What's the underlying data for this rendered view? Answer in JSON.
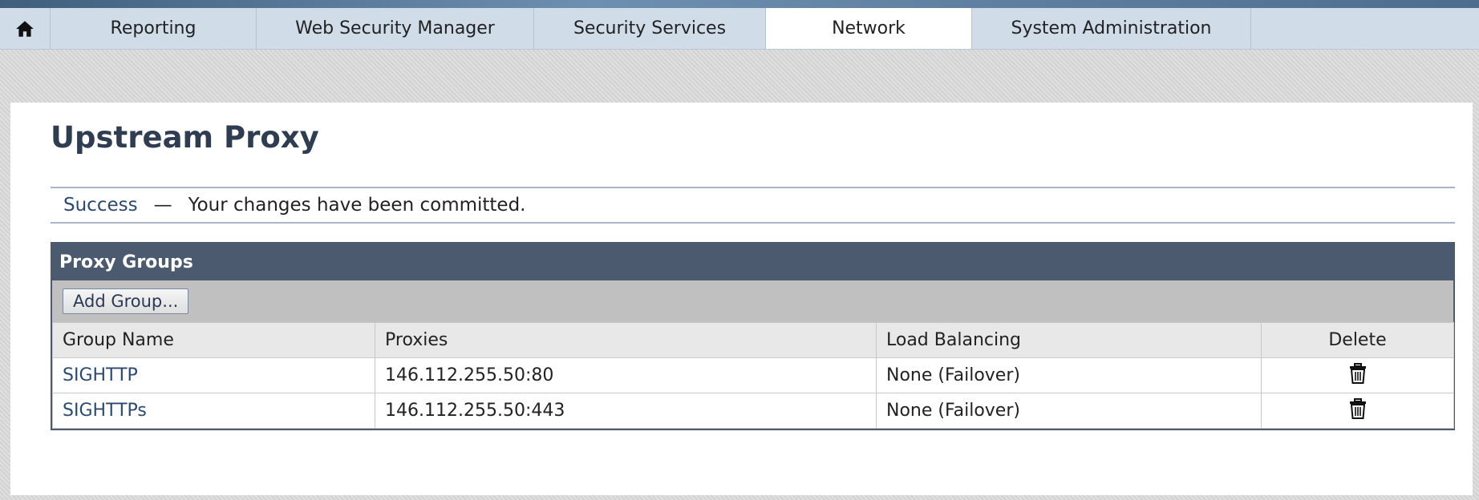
{
  "nav": {
    "home_icon": "home-icon",
    "tabs": [
      {
        "label": "Reporting",
        "active": false
      },
      {
        "label": "Web Security Manager",
        "active": false
      },
      {
        "label": "Security Services",
        "active": false
      },
      {
        "label": "Network",
        "active": true
      },
      {
        "label": "System Administration",
        "active": false
      }
    ]
  },
  "page": {
    "title": "Upstream Proxy"
  },
  "status": {
    "label": "Success",
    "separator": "—",
    "message": "Your changes have been committed."
  },
  "proxy_groups": {
    "title": "Proxy Groups",
    "add_button": "Add Group...",
    "columns": [
      "Group Name",
      "Proxies",
      "Load Balancing",
      "Delete"
    ],
    "rows": [
      {
        "name": "SIGHTTP",
        "proxies": "146.112.255.50:80",
        "load_balancing": "None (Failover)"
      },
      {
        "name": "SIGHTTPs",
        "proxies": "146.112.255.50:443",
        "load_balancing": "None (Failover)"
      }
    ],
    "delete_icon": "trash-icon"
  },
  "colors": {
    "header_bg": "#4b5a6e",
    "link": "#2a4a72",
    "nav_bg": "#d0dde9"
  }
}
